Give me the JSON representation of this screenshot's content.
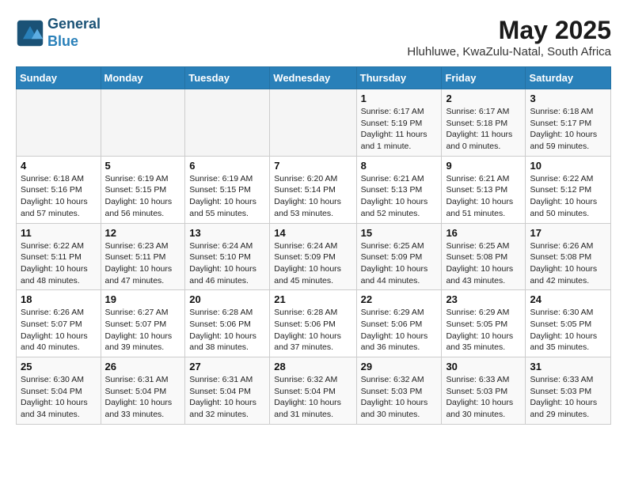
{
  "header": {
    "logo_line1": "General",
    "logo_line2": "Blue",
    "month": "May 2025",
    "location": "Hluhluwe, KwaZulu-Natal, South Africa"
  },
  "days_of_week": [
    "Sunday",
    "Monday",
    "Tuesday",
    "Wednesday",
    "Thursday",
    "Friday",
    "Saturday"
  ],
  "weeks": [
    [
      {
        "day": "",
        "info": ""
      },
      {
        "day": "",
        "info": ""
      },
      {
        "day": "",
        "info": ""
      },
      {
        "day": "",
        "info": ""
      },
      {
        "day": "1",
        "info": "Sunrise: 6:17 AM\nSunset: 5:19 PM\nDaylight: 11 hours\nand 1 minute."
      },
      {
        "day": "2",
        "info": "Sunrise: 6:17 AM\nSunset: 5:18 PM\nDaylight: 11 hours\nand 0 minutes."
      },
      {
        "day": "3",
        "info": "Sunrise: 6:18 AM\nSunset: 5:17 PM\nDaylight: 10 hours\nand 59 minutes."
      }
    ],
    [
      {
        "day": "4",
        "info": "Sunrise: 6:18 AM\nSunset: 5:16 PM\nDaylight: 10 hours\nand 57 minutes."
      },
      {
        "day": "5",
        "info": "Sunrise: 6:19 AM\nSunset: 5:15 PM\nDaylight: 10 hours\nand 56 minutes."
      },
      {
        "day": "6",
        "info": "Sunrise: 6:19 AM\nSunset: 5:15 PM\nDaylight: 10 hours\nand 55 minutes."
      },
      {
        "day": "7",
        "info": "Sunrise: 6:20 AM\nSunset: 5:14 PM\nDaylight: 10 hours\nand 53 minutes."
      },
      {
        "day": "8",
        "info": "Sunrise: 6:21 AM\nSunset: 5:13 PM\nDaylight: 10 hours\nand 52 minutes."
      },
      {
        "day": "9",
        "info": "Sunrise: 6:21 AM\nSunset: 5:13 PM\nDaylight: 10 hours\nand 51 minutes."
      },
      {
        "day": "10",
        "info": "Sunrise: 6:22 AM\nSunset: 5:12 PM\nDaylight: 10 hours\nand 50 minutes."
      }
    ],
    [
      {
        "day": "11",
        "info": "Sunrise: 6:22 AM\nSunset: 5:11 PM\nDaylight: 10 hours\nand 48 minutes."
      },
      {
        "day": "12",
        "info": "Sunrise: 6:23 AM\nSunset: 5:11 PM\nDaylight: 10 hours\nand 47 minutes."
      },
      {
        "day": "13",
        "info": "Sunrise: 6:24 AM\nSunset: 5:10 PM\nDaylight: 10 hours\nand 46 minutes."
      },
      {
        "day": "14",
        "info": "Sunrise: 6:24 AM\nSunset: 5:09 PM\nDaylight: 10 hours\nand 45 minutes."
      },
      {
        "day": "15",
        "info": "Sunrise: 6:25 AM\nSunset: 5:09 PM\nDaylight: 10 hours\nand 44 minutes."
      },
      {
        "day": "16",
        "info": "Sunrise: 6:25 AM\nSunset: 5:08 PM\nDaylight: 10 hours\nand 43 minutes."
      },
      {
        "day": "17",
        "info": "Sunrise: 6:26 AM\nSunset: 5:08 PM\nDaylight: 10 hours\nand 42 minutes."
      }
    ],
    [
      {
        "day": "18",
        "info": "Sunrise: 6:26 AM\nSunset: 5:07 PM\nDaylight: 10 hours\nand 40 minutes."
      },
      {
        "day": "19",
        "info": "Sunrise: 6:27 AM\nSunset: 5:07 PM\nDaylight: 10 hours\nand 39 minutes."
      },
      {
        "day": "20",
        "info": "Sunrise: 6:28 AM\nSunset: 5:06 PM\nDaylight: 10 hours\nand 38 minutes."
      },
      {
        "day": "21",
        "info": "Sunrise: 6:28 AM\nSunset: 5:06 PM\nDaylight: 10 hours\nand 37 minutes."
      },
      {
        "day": "22",
        "info": "Sunrise: 6:29 AM\nSunset: 5:06 PM\nDaylight: 10 hours\nand 36 minutes."
      },
      {
        "day": "23",
        "info": "Sunrise: 6:29 AM\nSunset: 5:05 PM\nDaylight: 10 hours\nand 35 minutes."
      },
      {
        "day": "24",
        "info": "Sunrise: 6:30 AM\nSunset: 5:05 PM\nDaylight: 10 hours\nand 35 minutes."
      }
    ],
    [
      {
        "day": "25",
        "info": "Sunrise: 6:30 AM\nSunset: 5:04 PM\nDaylight: 10 hours\nand 34 minutes."
      },
      {
        "day": "26",
        "info": "Sunrise: 6:31 AM\nSunset: 5:04 PM\nDaylight: 10 hours\nand 33 minutes."
      },
      {
        "day": "27",
        "info": "Sunrise: 6:31 AM\nSunset: 5:04 PM\nDaylight: 10 hours\nand 32 minutes."
      },
      {
        "day": "28",
        "info": "Sunrise: 6:32 AM\nSunset: 5:04 PM\nDaylight: 10 hours\nand 31 minutes."
      },
      {
        "day": "29",
        "info": "Sunrise: 6:32 AM\nSunset: 5:03 PM\nDaylight: 10 hours\nand 30 minutes."
      },
      {
        "day": "30",
        "info": "Sunrise: 6:33 AM\nSunset: 5:03 PM\nDaylight: 10 hours\nand 30 minutes."
      },
      {
        "day": "31",
        "info": "Sunrise: 6:33 AM\nSunset: 5:03 PM\nDaylight: 10 hours\nand 29 minutes."
      }
    ]
  ]
}
